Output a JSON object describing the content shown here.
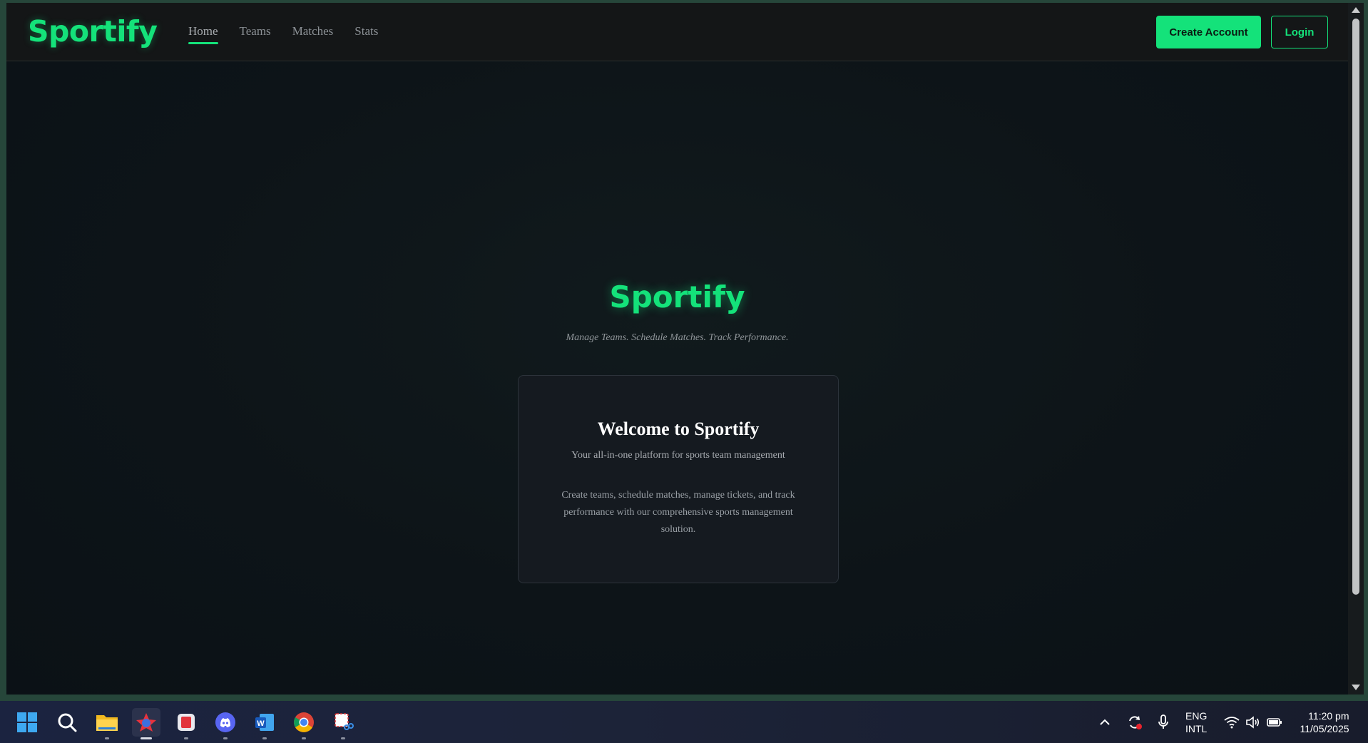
{
  "nav": {
    "brand": "Sportify",
    "links": [
      {
        "label": "Home",
        "active": true
      },
      {
        "label": "Teams",
        "active": false
      },
      {
        "label": "Matches",
        "active": false
      },
      {
        "label": "Stats",
        "active": false
      }
    ],
    "create_account_label": "Create Account",
    "login_label": "Login"
  },
  "hero": {
    "title": "Sportify",
    "subtitle": "Manage Teams. Schedule Matches. Track Performance."
  },
  "card": {
    "title": "Welcome to Sportify",
    "tagline": "Your all-in-one platform for sports team management",
    "body": "Create teams, schedule matches, manage tickets, and track performance with our comprehensive sports management solution."
  },
  "taskbar": {
    "apps": [
      "windows-start-icon",
      "search-icon",
      "file-explorer-icon",
      "app-icon",
      "red-app-icon",
      "discord-icon",
      "word-icon",
      "chrome-icon",
      "snipping-tool-icon"
    ],
    "language_line1": "ENG",
    "language_line2": "INTL",
    "time": "11:20 pm",
    "date": "11/05/2025"
  },
  "colors": {
    "accent": "#14e27a",
    "background": "#0d1418",
    "card": "#151a20"
  }
}
